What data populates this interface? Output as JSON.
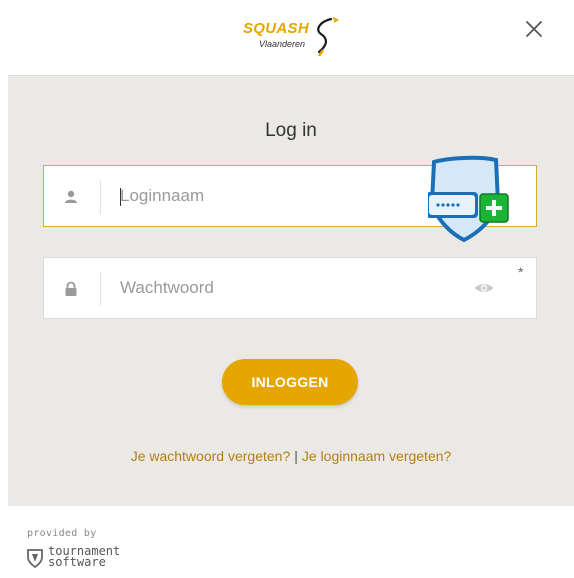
{
  "header": {
    "logo_main": "SQUASH",
    "logo_sub": "Vlaanderen",
    "close_label": "×"
  },
  "form": {
    "title": "Log in",
    "username": {
      "placeholder": "Loginnaam",
      "value": "",
      "icon": "user-icon"
    },
    "password": {
      "placeholder": "Wachtwoord",
      "value": "",
      "icon": "lock-icon",
      "required_mark": "*"
    },
    "submit_label": "INLOGGEN",
    "links": {
      "forgot_password": "Je wachtwoord vergeten?",
      "separator": "|",
      "forgot_username": "Je loginnaam vergeten?"
    }
  },
  "footer": {
    "provided_by": "provided by",
    "brand_line1": "tournament",
    "brand_line2": "software"
  },
  "colors": {
    "accent": "#e6a600",
    "link": "#b57f10",
    "panel_bg": "#ebe9e5",
    "focus_border": "#d9a928"
  }
}
